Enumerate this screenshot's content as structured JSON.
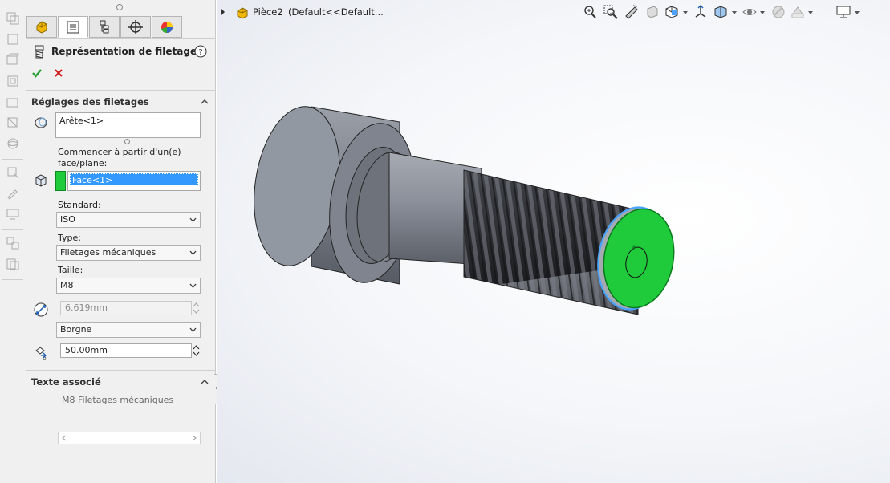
{
  "panel": {
    "title": "Représentation de filetage",
    "thread_settings": {
      "header": "Réglages des filetages",
      "edge_selection": "Arête<1>",
      "start_from_label": "Commencer à partir d'un(e) face/plane:",
      "start_face_selection": "Face<1>",
      "standard_label": "Standard:",
      "standard_value": "ISO",
      "type_label": "Type:",
      "type_value": "Filetages mécaniques",
      "size_label": "Taille:",
      "size_value": "M8",
      "major_diameter": "6.619mm",
      "end_condition": "Borgne",
      "depth": "50.00mm"
    },
    "associated_text": {
      "header": "Texte associé",
      "value": "M8 Filetages mécaniques"
    }
  },
  "graphics": {
    "part_name": "Pièce2",
    "configuration": "(Default<<Default..."
  },
  "colors": {
    "accept": "#1f9d2a",
    "cancel": "#d11a1a",
    "selection_green": "#1fcb3a",
    "highlight_blue": "#4aa3ff",
    "part_gray": "#8a8f99"
  }
}
